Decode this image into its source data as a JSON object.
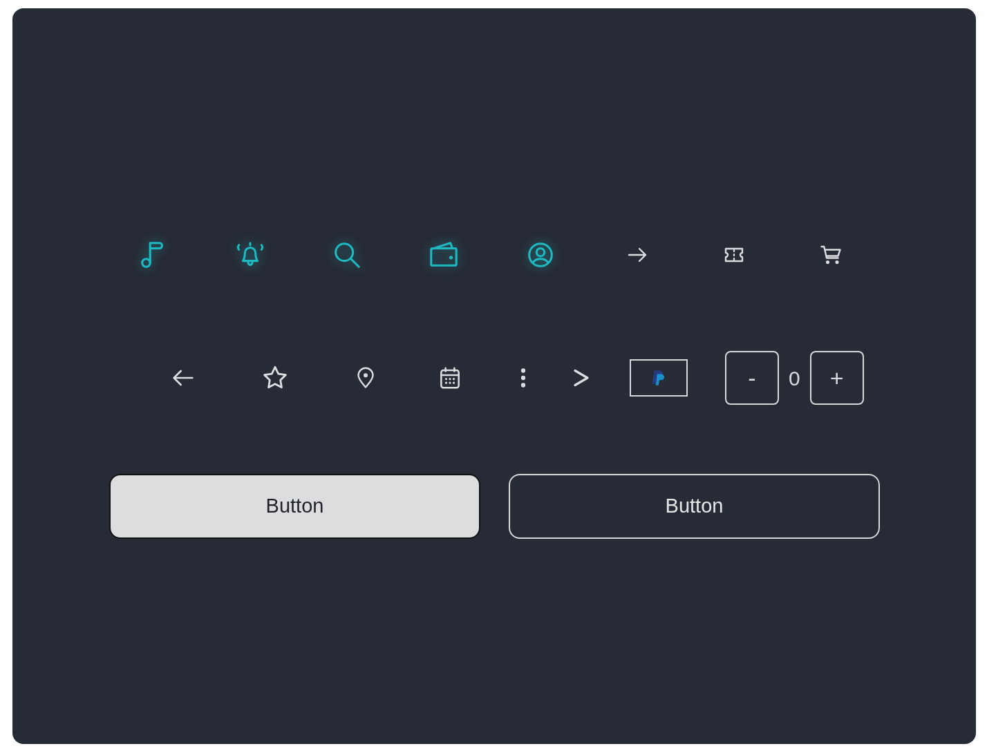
{
  "top_icons": [
    {
      "glowing": true
    },
    {
      "glowing": true
    },
    {
      "glowing": true
    },
    {
      "glowing": true
    },
    {
      "glowing": true
    },
    {
      "glowing": false
    },
    {
      "glowing": false
    },
    {
      "glowing": false
    }
  ],
  "stepper": {
    "minus": "-",
    "value": "0",
    "plus": "+"
  },
  "buttons": [
    {
      "kind": "filled",
      "label": "Button"
    },
    {
      "kind": "outline",
      "label": "Button"
    }
  ]
}
